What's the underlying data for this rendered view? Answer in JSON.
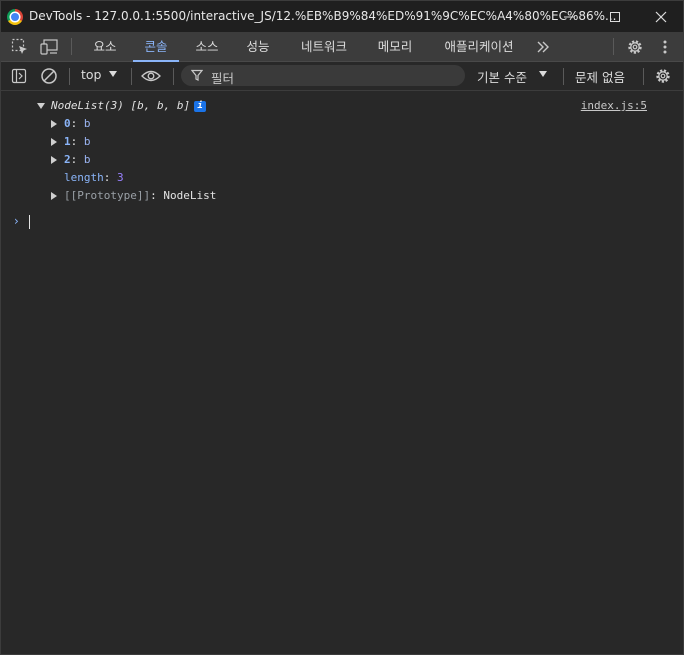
{
  "window": {
    "title": "DevTools - 127.0.0.1:5500/interactive_JS/12.%EB%B9%84%ED%91%9C%EC%A4%80%EC%86%..."
  },
  "tabs": [
    {
      "label": "요소"
    },
    {
      "label": "콘솔",
      "active": true
    },
    {
      "label": "소스"
    },
    {
      "label": "성능"
    },
    {
      "label": "네트워크"
    },
    {
      "label": "메모리"
    },
    {
      "label": "애플리케이션"
    }
  ],
  "toolbar": {
    "context": "top",
    "filter_placeholder": "필터",
    "levels": "기본 수준",
    "issues": "문제 없음"
  },
  "console": {
    "entry": {
      "summary": "NodeList(3) [b, b, b]",
      "source": "index.js:5",
      "items": [
        {
          "key": "0",
          "value": "b"
        },
        {
          "key": "1",
          "value": "b"
        },
        {
          "key": "2",
          "value": "b"
        }
      ],
      "length_key": "length",
      "length_value": "3",
      "prototype_key": "[[Prototype]]",
      "prototype_value": "NodeList"
    },
    "prompt_symbol": "›"
  },
  "colors": {
    "accent": "#8ab4f8",
    "background": "#282828",
    "titlebar": "#1f1f1f",
    "tabbar": "#3c3c3c"
  }
}
